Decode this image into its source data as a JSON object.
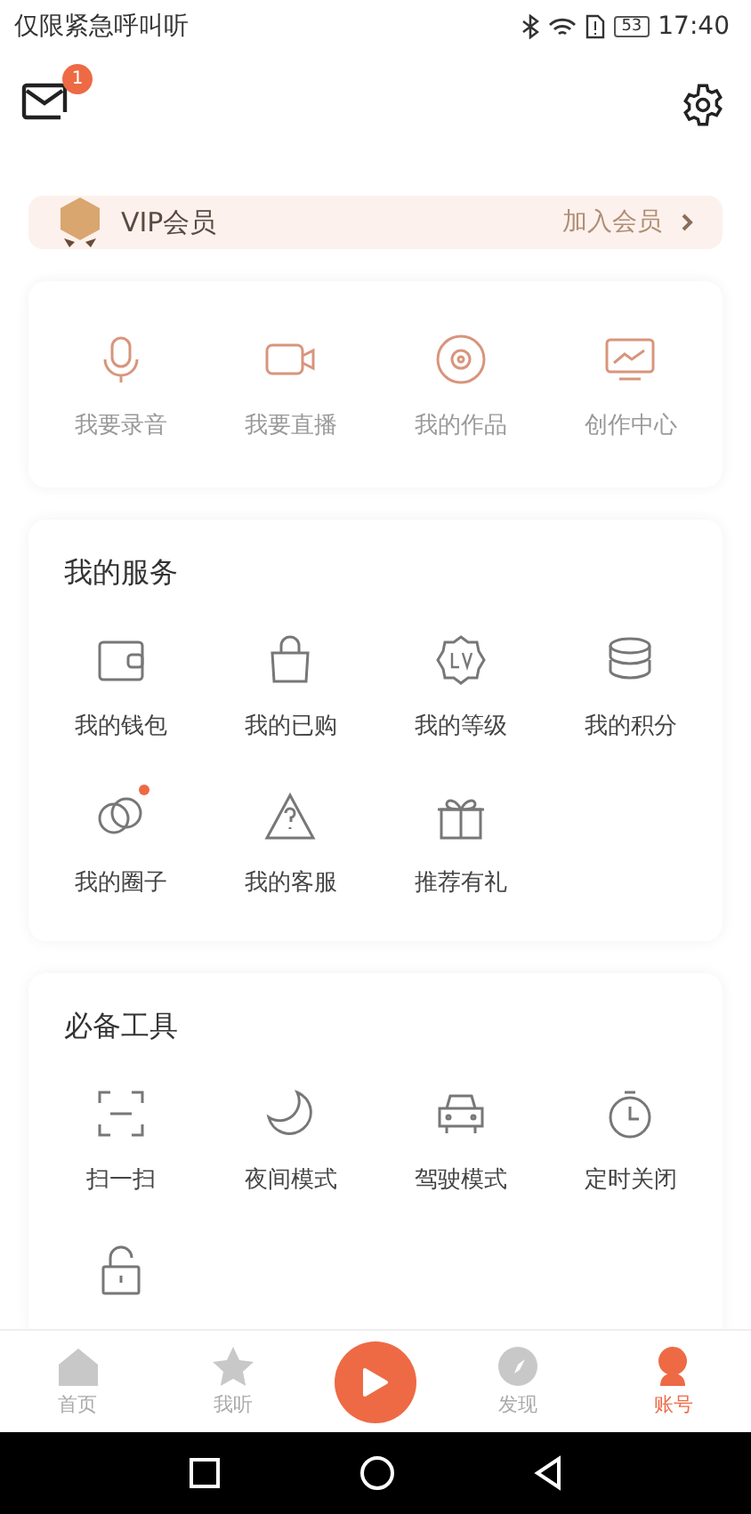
{
  "status_bar": {
    "carrier": "仅限紧急呼叫听",
    "battery": "53",
    "time": "17:40"
  },
  "header": {
    "unread": "1"
  },
  "vip": {
    "title": "VIP会员",
    "action": "加入会员"
  },
  "quick_actions": [
    {
      "label": "我要录音"
    },
    {
      "label": "我要直播"
    },
    {
      "label": "我的作品"
    },
    {
      "label": "创作中心"
    }
  ],
  "services": {
    "title": "我的服务",
    "items": [
      {
        "label": "我的钱包",
        "dot": false
      },
      {
        "label": "我的已购",
        "dot": false
      },
      {
        "label": "我的等级",
        "dot": false
      },
      {
        "label": "我的积分",
        "dot": false
      },
      {
        "label": "我的圈子",
        "dot": true
      },
      {
        "label": "我的客服",
        "dot": false
      },
      {
        "label": "推荐有礼",
        "dot": false
      }
    ]
  },
  "tools": {
    "title": "必备工具",
    "items": [
      {
        "label": "扫一扫"
      },
      {
        "label": "夜间模式"
      },
      {
        "label": "驾驶模式"
      },
      {
        "label": "定时关闭"
      }
    ]
  },
  "tabs": [
    {
      "label": "首页",
      "selected": false
    },
    {
      "label": "我听",
      "selected": false
    },
    {
      "label": "发现",
      "selected": false
    },
    {
      "label": "账号",
      "selected": true
    }
  ]
}
